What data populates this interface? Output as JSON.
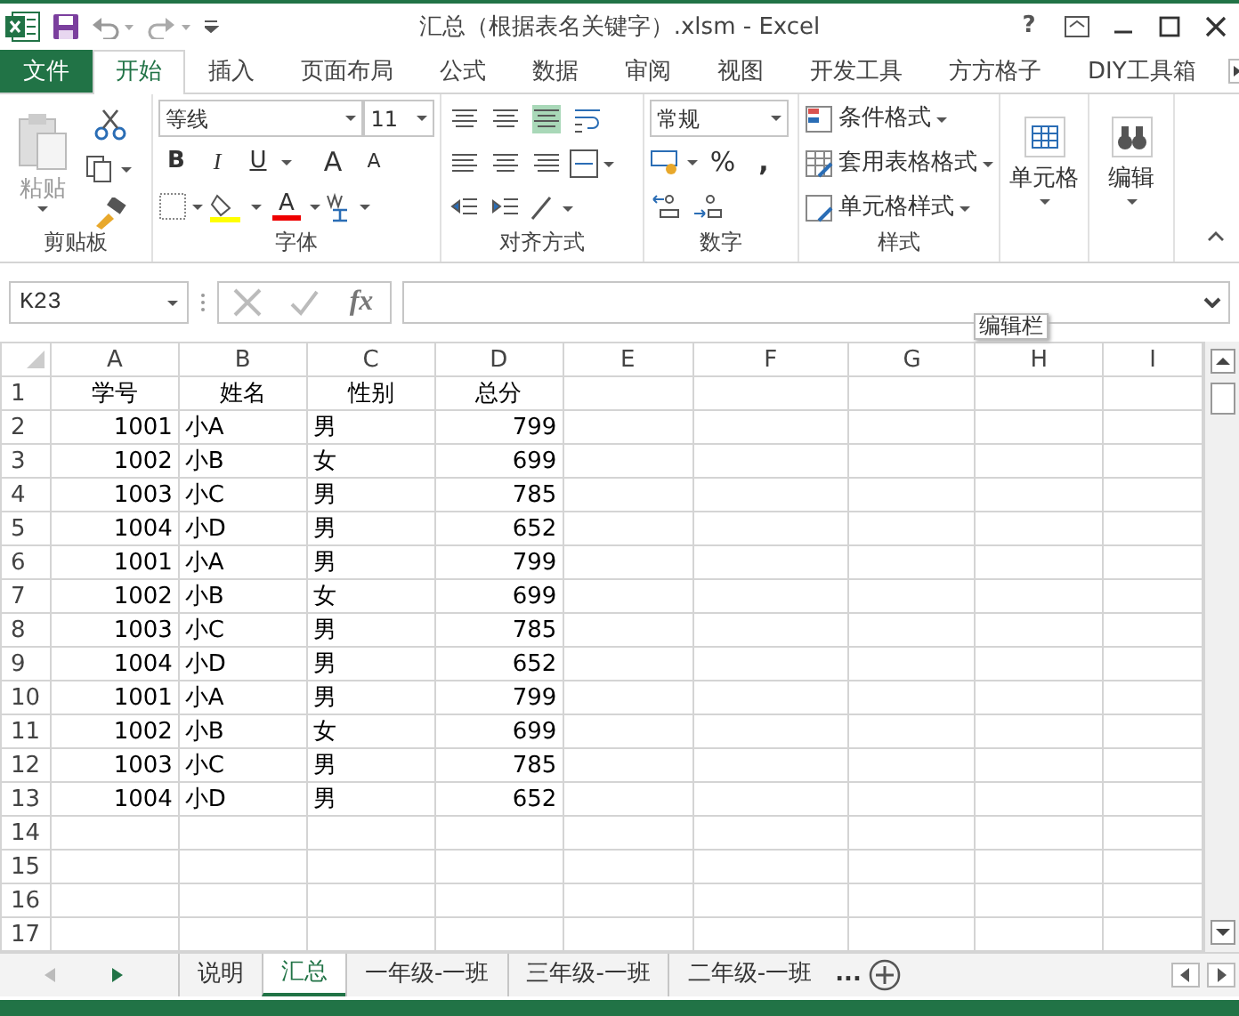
{
  "window": {
    "title": "汇总（根据表名关键字）.xlsm - Excel",
    "help": "?"
  },
  "ribbon_tabs": [
    {
      "label": "文件",
      "kind": "file",
      "selected": false
    },
    {
      "label": "开始",
      "kind": "tab",
      "selected": true
    },
    {
      "label": "插入",
      "kind": "tab",
      "selected": false
    },
    {
      "label": "页面布局",
      "kind": "tab",
      "selected": false
    },
    {
      "label": "公式",
      "kind": "tab",
      "selected": false
    },
    {
      "label": "数据",
      "kind": "tab",
      "selected": false
    },
    {
      "label": "审阅",
      "kind": "tab",
      "selected": false
    },
    {
      "label": "视图",
      "kind": "tab",
      "selected": false
    },
    {
      "label": "开发工具",
      "kind": "tab",
      "selected": false
    },
    {
      "label": "方方格子",
      "kind": "tab",
      "selected": false
    },
    {
      "label": "DIY工具箱",
      "kind": "tab",
      "selected": false
    }
  ],
  "ribbon": {
    "clipboard": {
      "paste": "粘贴",
      "label": "剪贴板"
    },
    "font": {
      "name": "等线",
      "size": "11",
      "bold": "B",
      "italic": "I",
      "underline": "U",
      "grow": "A",
      "shrink": "A",
      "color_letter": "A",
      "label": "字体"
    },
    "alignment": {
      "label": "对齐方式"
    },
    "number": {
      "format": "常规",
      "percent": "%",
      "comma": ",",
      "label": "数字"
    },
    "styles": {
      "items": [
        "条件格式",
        "套用表格格式",
        "单元格样式"
      ],
      "label": "样式"
    },
    "cells": {
      "label": "单元格"
    },
    "editing": {
      "label": "编辑"
    }
  },
  "formula_bar": {
    "name_box": "K23",
    "fx": "fx",
    "tooltip": "编辑栏"
  },
  "sheet": {
    "columns": [
      "A",
      "B",
      "C",
      "D",
      "E",
      "F",
      "G",
      "H",
      "I"
    ],
    "row_numbers": [
      "1",
      "2",
      "3",
      "4",
      "5",
      "6",
      "7",
      "8",
      "9",
      "10",
      "11",
      "12",
      "13",
      "14",
      "15",
      "16",
      "17"
    ],
    "rows": [
      [
        "学号",
        "姓名",
        "性别",
        "总分"
      ],
      [
        "1001",
        "小A",
        "男",
        "799"
      ],
      [
        "1002",
        "小B",
        "女",
        "699"
      ],
      [
        "1003",
        "小C",
        "男",
        "785"
      ],
      [
        "1004",
        "小D",
        "男",
        "652"
      ],
      [
        "1001",
        "小A",
        "男",
        "799"
      ],
      [
        "1002",
        "小B",
        "女",
        "699"
      ],
      [
        "1003",
        "小C",
        "男",
        "785"
      ],
      [
        "1004",
        "小D",
        "男",
        "652"
      ],
      [
        "1001",
        "小A",
        "男",
        "799"
      ],
      [
        "1002",
        "小B",
        "女",
        "699"
      ],
      [
        "1003",
        "小C",
        "男",
        "785"
      ],
      [
        "1004",
        "小D",
        "男",
        "652"
      ]
    ]
  },
  "sheet_tabs": [
    {
      "label": "说明",
      "selected": false
    },
    {
      "label": "汇总",
      "selected": true
    },
    {
      "label": "一年级-一班",
      "selected": false
    },
    {
      "label": "三年级-一班",
      "selected": false
    },
    {
      "label": "二年级-一班",
      "selected": false
    }
  ],
  "more_sheets": "..."
}
